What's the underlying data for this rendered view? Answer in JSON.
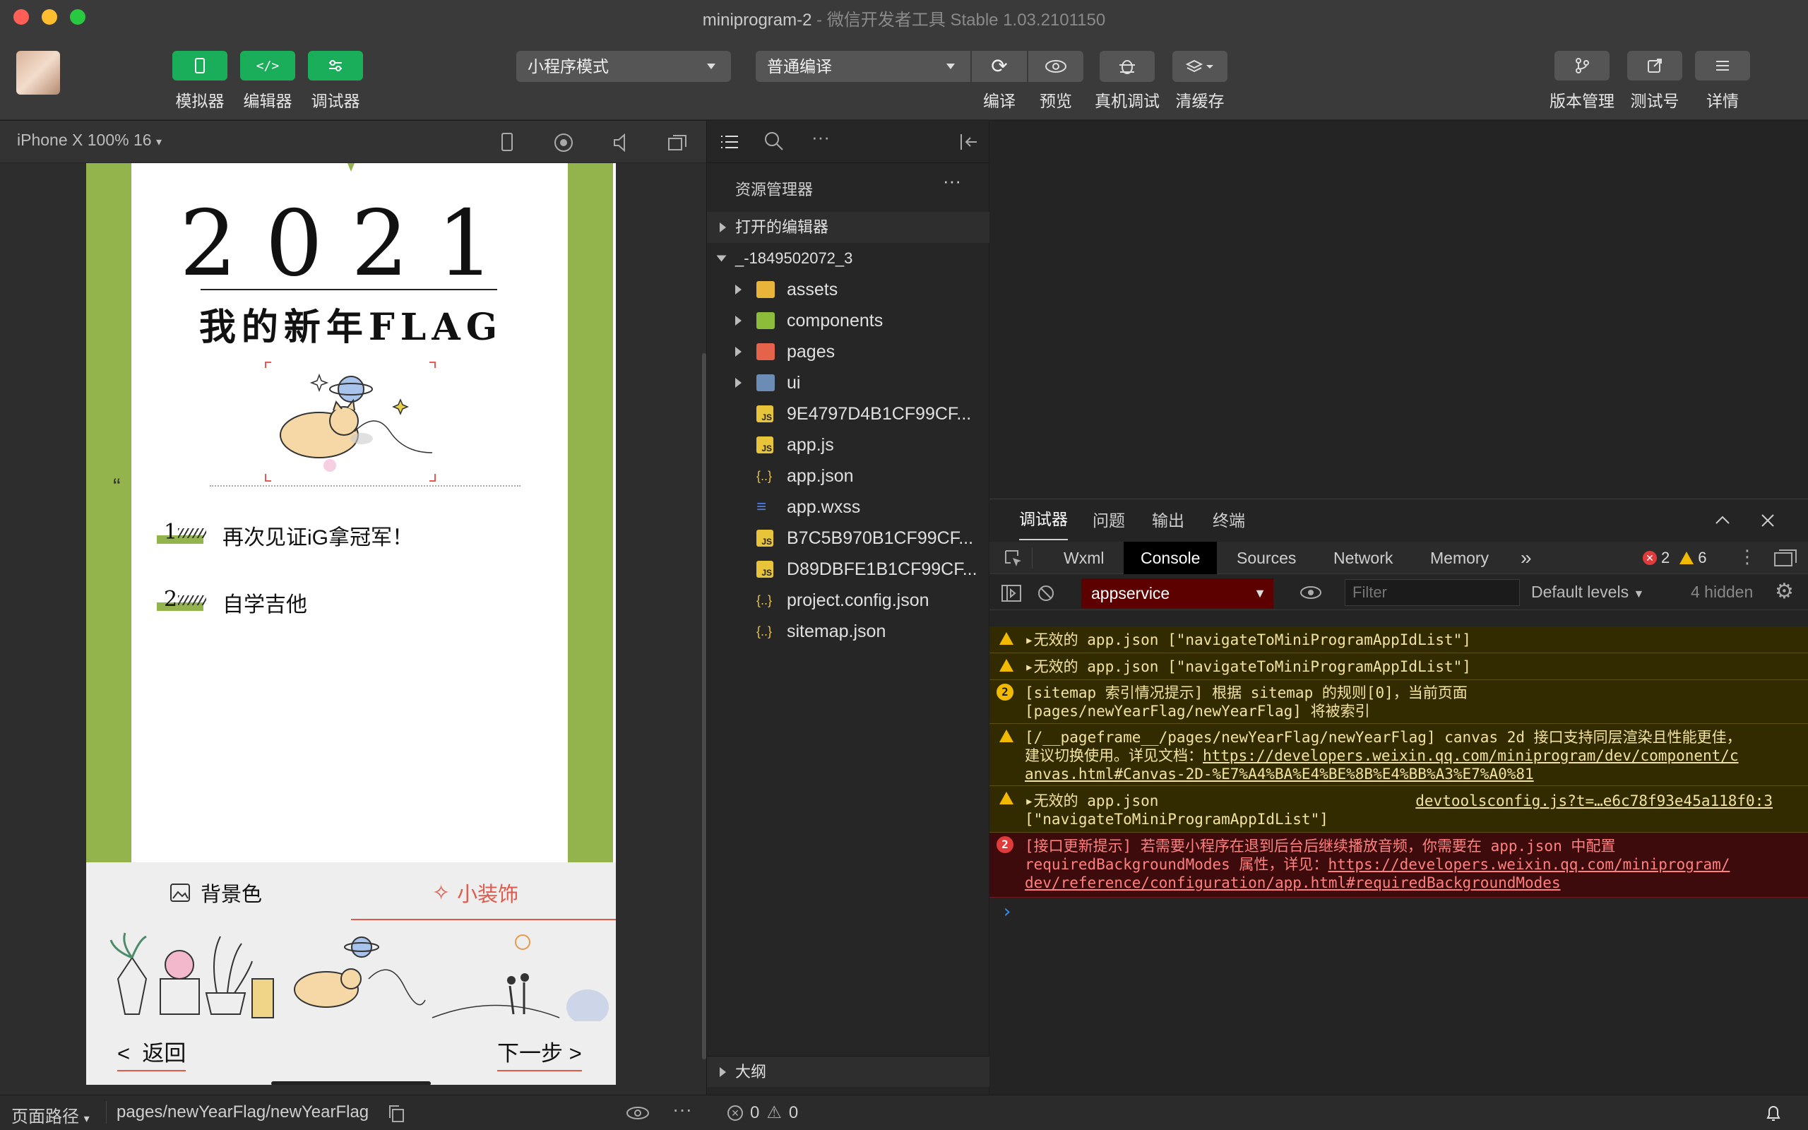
{
  "window": {
    "title": "miniprogram-2",
    "subtitle": " - 微信开发者工具 Stable 1.03.2101150"
  },
  "toolbar": {
    "left_buttons": [
      "模拟器",
      "编辑器",
      "调试器"
    ],
    "mode_select": "小程序模式",
    "compile_select": "普通编译",
    "mid_buttons": [
      "编译",
      "预览",
      "真机调试",
      "清缓存"
    ],
    "right_buttons": [
      "版本管理",
      "测试号",
      "详情"
    ]
  },
  "simulator": {
    "device": "iPhone X 100% 16",
    "page": {
      "year": "2021",
      "title": "我的新年FLAG",
      "quote": "“",
      "flags": [
        {
          "num": "1",
          "text": "再次见证iG拿冠军！"
        },
        {
          "num": "2",
          "text": "自学吉他"
        }
      ],
      "tabs": [
        "背景色",
        "小装饰"
      ],
      "back": "返回",
      "next": "下一步"
    }
  },
  "explorer": {
    "title": "资源管理器",
    "open_editors": "打开的编辑器",
    "project": "_-1849502072_3",
    "items": [
      {
        "name": "assets",
        "kind": "folder"
      },
      {
        "name": "components",
        "kind": "folder"
      },
      {
        "name": "pages",
        "kind": "folder"
      },
      {
        "name": "ui",
        "kind": "folder"
      },
      {
        "name": "9E4797D4B1CF99CF...",
        "kind": "js"
      },
      {
        "name": "app.js",
        "kind": "js"
      },
      {
        "name": "app.json",
        "kind": "json"
      },
      {
        "name": "app.wxss",
        "kind": "css"
      },
      {
        "name": "B7C5B970B1CF99CF...",
        "kind": "js"
      },
      {
        "name": "D89DBFE1B1CF99CF...",
        "kind": "js"
      },
      {
        "name": "project.config.json",
        "kind": "json"
      },
      {
        "name": "sitemap.json",
        "kind": "json"
      }
    ],
    "outline": "大纲"
  },
  "devtools": {
    "panel_tabs": [
      "调试器",
      "问题",
      "输出",
      "终端"
    ],
    "tool_tabs": [
      "Wxml",
      "Console",
      "Sources",
      "Network",
      "Memory",
      "»"
    ],
    "active_tool_tab": "Console",
    "error_count": "2",
    "warn_count": "6",
    "context": "appservice",
    "filter_placeholder": "Filter",
    "levels": "Default levels",
    "hidden": "4 hidden",
    "logs": [
      {
        "type": "warn",
        "lines": [
          "▸无效的 app.json [\"navigateToMiniProgramAppIdList\"]"
        ]
      },
      {
        "type": "warn",
        "lines": [
          "▸无效的 app.json [\"navigateToMiniProgramAppIdList\"]"
        ]
      },
      {
        "type": "warn-count",
        "count": "2",
        "lines": [
          "[sitemap 索引情况提示] 根据 sitemap 的规则[0]，当前页面",
          "[pages/newYearFlag/newYearFlag] 将被索引"
        ]
      },
      {
        "type": "warn",
        "lines": [
          "[/__pageframe__/pages/newYearFlag/newYearFlag] canvas 2d 接口支持同层渲染且性能更佳，",
          "建议切换使用。详见文档：",
          "anvas.html#Canvas-2D-%E7%A4%BA%E4%BE%8B%E4%BB%A3%E7%A0%81"
        ],
        "link": "https://developers.weixin.qq.com/miniprogram/dev/component/c"
      },
      {
        "type": "warn",
        "lines": [
          "▸无效的 app.json",
          "[\"navigateToMiniProgramAppIdList\"]"
        ],
        "source": "devtoolsconfig.js?t=…e6c78f93e45a118f0:3"
      },
      {
        "type": "err-count",
        "count": "2",
        "lines": [
          "[接口更新提示] 若需要小程序在退到后台后继续播放音频，你需要在 app.json 中配置",
          "requiredBackgroundModes 属性，详见：",
          "dev/reference/configuration/app.html#requiredBackgroundModes"
        ],
        "link": "https://developers.weixin.qq.com/miniprogram/"
      }
    ],
    "prompt": "›"
  },
  "statusbar": {
    "label": "页面路径",
    "path": "pages/newYearFlag/newYearFlag",
    "errors": "0",
    "warnings": "0"
  }
}
